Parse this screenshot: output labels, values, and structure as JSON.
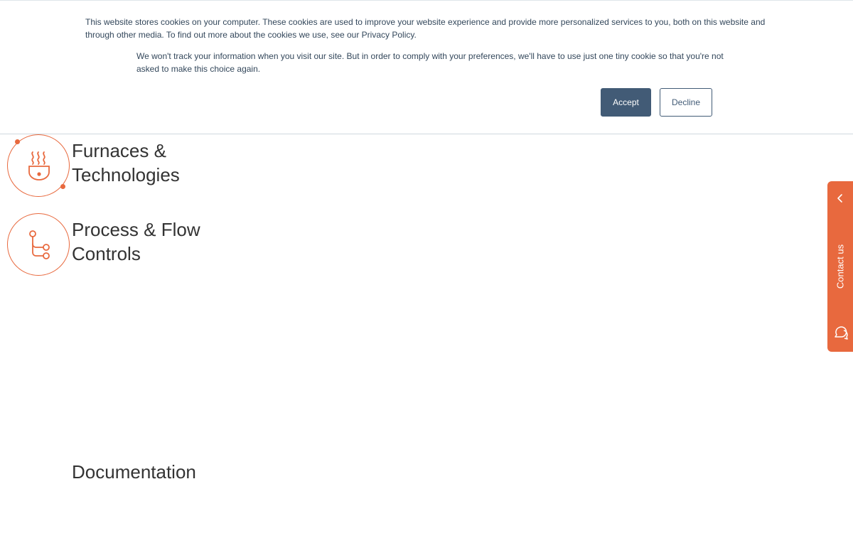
{
  "cookie_banner": {
    "text_main": "This website stores cookies on your computer. These cookies are used to improve your website experience and provide more personalized services to you, both on this website and through other media. To find out more about the cookies we use, see our Privacy Policy.",
    "text_secondary": "We won't track your information when you visit our site. But in order to comply with your preferences, we'll have to use just one tiny cookie so that you're not asked to make this choice again.",
    "accept_label": "Accept",
    "decline_label": "Decline"
  },
  "services": [
    {
      "title": "Furnaces & Technologies",
      "icon": "furnace-icon"
    },
    {
      "title": "Process & Flow Controls",
      "icon": "process-flow-icon"
    }
  ],
  "documentation": {
    "title": "Documentation"
  },
  "contact_tab": {
    "label": "Contact us",
    "icons": [
      "chevron-left-icon",
      "chat-icon"
    ]
  },
  "colors": {
    "accent": "#e8693e",
    "button_primary": "#425b76",
    "text": "#333333"
  }
}
